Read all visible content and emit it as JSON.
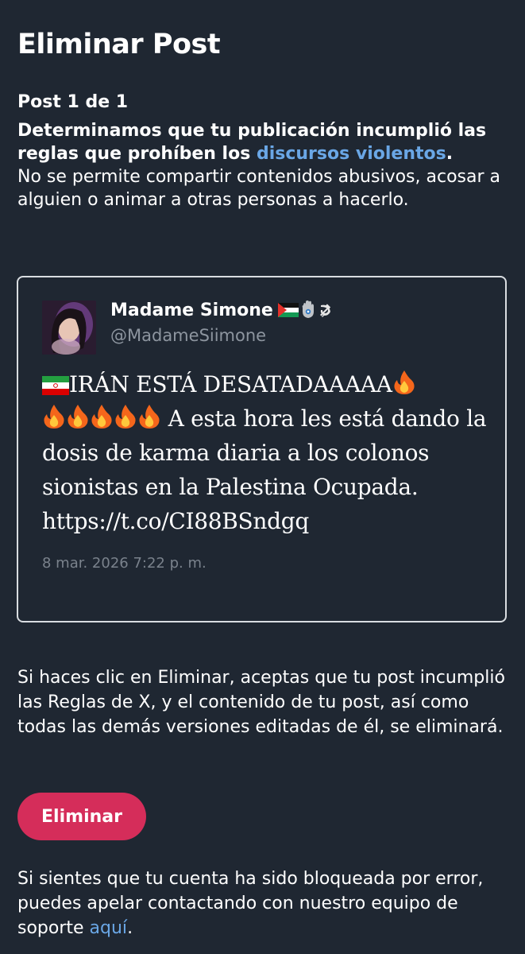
{
  "page": {
    "title": "Eliminar Post"
  },
  "violation": {
    "counter": "Post 1 de 1",
    "headline_prefix": "Determinamos que tu publicación incumplió las reglas que prohíben los ",
    "headline_link": "discursos violentos",
    "headline_suffix": ".",
    "explanation": "No se permite compartir contenidos abusivos, acosar a alguien o animar a otras personas a hacerlo."
  },
  "post": {
    "display_name": "Madame Simone",
    "name_emojis": [
      "palestine-flag",
      "hamsa",
      "hammer-and-sickle"
    ],
    "username": "@MadameSiimone",
    "text_part1": "IRÁN ESTÁ DESATADAAAAA",
    "text_part2": " A esta hora les está dando la dosis de karma diaria a los colonos sionistas en la Palestina Ocupada. https://t.co/CI88BSndgq",
    "leading_emoji": "iran-flag",
    "fire_emoji_count": 6,
    "date": "8 mar. 2026 7:22 p. m."
  },
  "notice": {
    "text": "Si haces clic en Eliminar, aceptas que tu post incumplió las Reglas de X, y el contenido de tu post, así como todas las demás versiones editadas de él, se eliminará."
  },
  "actions": {
    "delete_label": "Eliminar"
  },
  "appeal": {
    "text": "Si sientes que tu cuenta ha sido bloqueada por error, puedes apelar contactando con nuestro equipo de soporte ",
    "link": "aquí",
    "suffix": "."
  },
  "colors": {
    "background": "#1f2732",
    "accent_link": "#6aa7e6",
    "delete_button": "#d52d5a",
    "muted_text": "#8d959f"
  }
}
